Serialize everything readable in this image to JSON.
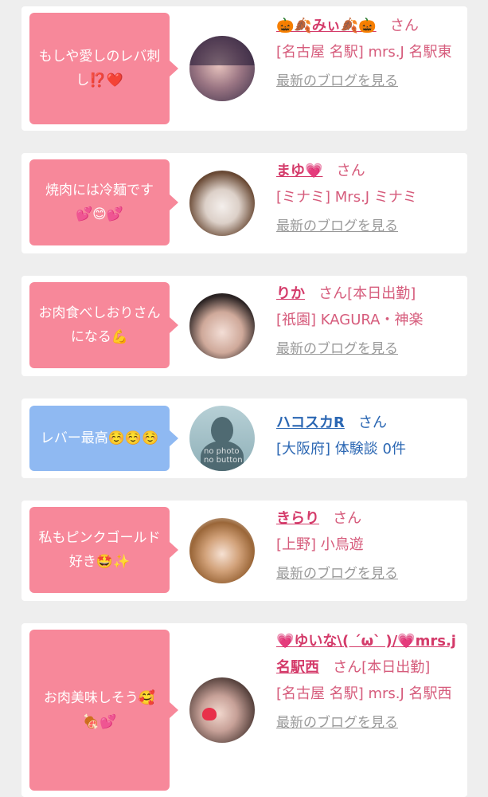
{
  "colors": {
    "bubble_pink": "#f7889a",
    "bubble_blue": "#8fb9f2",
    "name_pink": "#d43b6a",
    "name_blue": "#2b67b3",
    "link_gray": "#999999"
  },
  "entries": [
    {
      "comment": "もしや愛しのレバ刺し⁉️❤️",
      "name": "🎃🍂みぃ🍂🎃",
      "san": "さん",
      "shop": "[名古屋 名駅] mrs.J 名駅東",
      "blog_link": "最新のブログを見る"
    },
    {
      "comment": "焼肉には冷麺です💕😊💕",
      "name": "まゆ💗",
      "san": "さん",
      "shop": "[ミナミ] Mrs.J ミナミ",
      "blog_link": "最新のブログを見る"
    },
    {
      "comment": "お肉食べしおりさんになる💪",
      "name": "りか",
      "san": "さん[本日出勤]",
      "shop": "[祇園] KAGURA・神楽",
      "blog_link": "最新のブログを見る"
    },
    {
      "comment": "レバー最高☺️☺️☺️",
      "name": "ハコスカR",
      "san": "さん",
      "shop": "[大阪府] 体験談 0件",
      "avatar_text": "no photo\nno button"
    },
    {
      "comment": "私もピンクゴールド好き🤩✨",
      "name": "きらり",
      "san": "さん",
      "shop": "[上野] 小鳥遊",
      "blog_link": "最新のブログを見る"
    },
    {
      "comment": "お肉美味しそう🥰🍖💕",
      "name": "💗ゆいな\\( ´ω` )/💗mrs.j名駅西",
      "san": "さん[本日出勤]",
      "shop": "[名古屋 名駅] mrs.J 名駅西",
      "blog_link": "最新のブログを見る"
    }
  ]
}
